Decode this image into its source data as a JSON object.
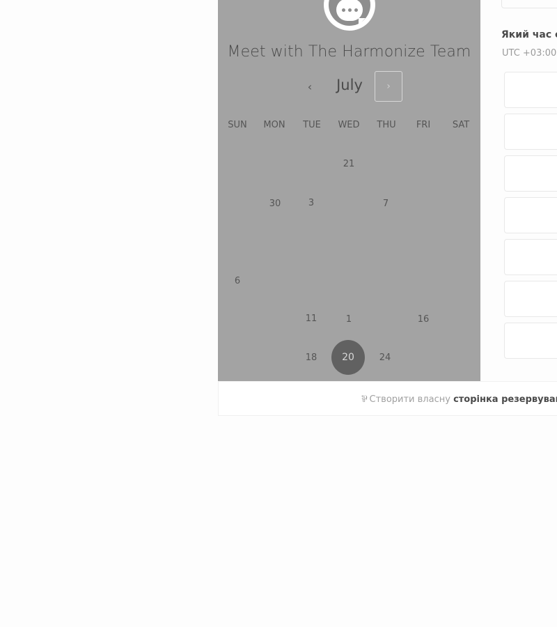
{
  "page": {
    "title": "Meet with The Harmonize Team"
  },
  "calendar": {
    "month": "July",
    "prev_icon": "‹",
    "next_icon": "›",
    "weekdays": [
      "SUN",
      "MON",
      "TUE",
      "WED",
      "THU",
      "FRI",
      "SAT"
    ],
    "days": {
      "d21": "21",
      "d30": "30",
      "d3": "3",
      "d7": "7",
      "d6": "6",
      "d11": "11",
      "d1": "1",
      "d16": "16",
      "d18": "18",
      "d20": "20",
      "d24": "24"
    },
    "selected_day": "20"
  },
  "times": {
    "question": "Який час є",
    "timezone": "UTC +03:00"
  },
  "footer": {
    "logo_icon": "hubspot-sprocket-icon",
    "logo_glyph": "⅌",
    "prefix": "Створити власну",
    "bold_text": "сторінка резервування з"
  },
  "colors": {
    "overlay": "#a3a3a3",
    "selected_day": "#616161",
    "background": "#fdfdfd"
  }
}
